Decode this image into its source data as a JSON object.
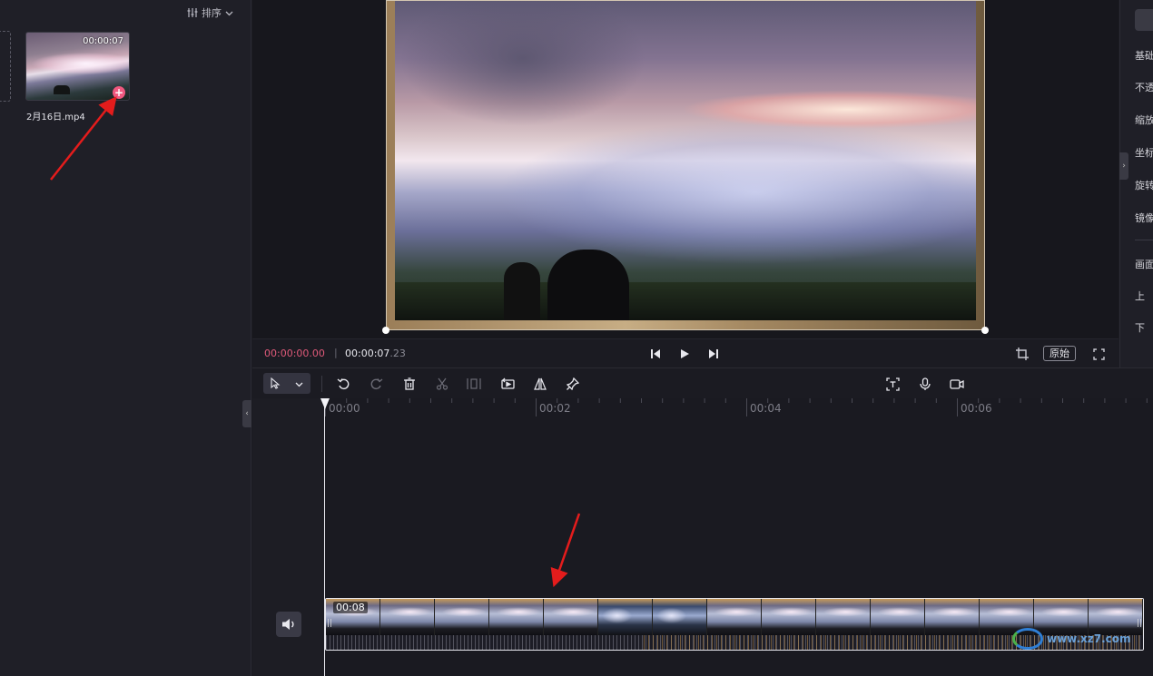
{
  "media_panel": {
    "sort_label": "排序",
    "clip": {
      "duration": "00:00:07",
      "add_symbol": "+",
      "filename": "2月16日.mp4"
    }
  },
  "playback": {
    "current_time": "00:00:00.00",
    "separator": "|",
    "total_time_main": "00:00:07",
    "total_time_ms": ".23",
    "original_ratio_label": "原始"
  },
  "properties": {
    "labels": [
      "基础",
      "不透",
      "缩放",
      "坐标",
      "旋转",
      "镜像",
      "画面",
      "上",
      "下"
    ],
    "toggle_symbol": "›"
  },
  "timeline": {
    "ruler_ticks": [
      "00:00",
      "00:02",
      "00:04",
      "00:06"
    ],
    "clip_start_label": "00:08",
    "collapse_symbol": "‹",
    "clip_edge_left": "||",
    "clip_edge_right": "||",
    "watermark_text": "www.xz7.com"
  },
  "colors": {
    "accent_timecode": "#e05a7a",
    "add_badge": "#f0587f",
    "annotation_arrow": "#e41c1c",
    "background": "#1b1b22"
  }
}
